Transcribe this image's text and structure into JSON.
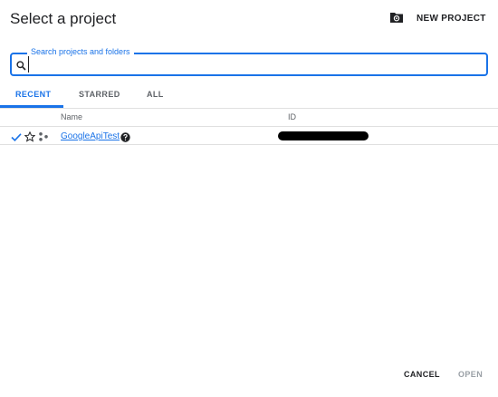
{
  "dialog": {
    "title": "Select a project",
    "new_project_label": "NEW PROJECT"
  },
  "search": {
    "label": "Search projects and folders",
    "value": "",
    "placeholder": ""
  },
  "tabs": [
    {
      "label": "RECENT",
      "active": true
    },
    {
      "label": "STARRED",
      "active": false
    },
    {
      "label": "ALL",
      "active": false
    }
  ],
  "table": {
    "columns": [
      "Name",
      "ID"
    ],
    "rows": [
      {
        "name": "GoogleApiTest",
        "id_redacted": true,
        "selected": true,
        "starred": false
      }
    ]
  },
  "footer": {
    "cancel_label": "CANCEL",
    "open_label": "OPEN"
  },
  "colors": {
    "accent": "#1a73e8",
    "text": "#202124",
    "muted": "#5f6368",
    "disabled": "#9aa0a6",
    "divider": "#e0e0e0"
  },
  "icons": {
    "new_project": "folder-settings-icon",
    "search": "search-icon",
    "selected": "check-icon",
    "star": "star-outline-icon",
    "organization": "organization-icon",
    "help": "help-icon"
  }
}
